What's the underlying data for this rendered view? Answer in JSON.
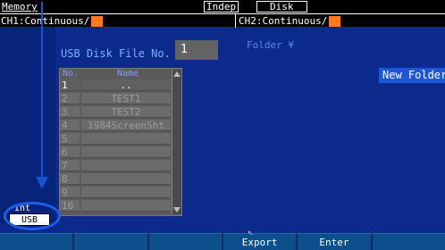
{
  "top_bar": {
    "menu": "Memory",
    "mode_badge": "Indep",
    "storage_badge": "Disk"
  },
  "channels": {
    "ch1": "CH1:Continuous/",
    "ch2": "CH2:Continuous/"
  },
  "panel": {
    "title": "USB Disk File No.",
    "file_no": "1",
    "folder_path": "Folder ¥",
    "new_folder_label": "New Folder"
  },
  "file_list": {
    "headers": {
      "no": "No.",
      "name": "Name"
    },
    "rows": [
      {
        "no": "1",
        "name": ".."
      },
      {
        "no": "2",
        "name": "TEST1"
      },
      {
        "no": "3",
        "name": "TEST2"
      },
      {
        "no": "4",
        "name": "1984ScreenSht"
      },
      {
        "no": "5",
        "name": ""
      },
      {
        "no": "6",
        "name": ""
      },
      {
        "no": "7",
        "name": ""
      },
      {
        "no": "8",
        "name": ""
      },
      {
        "no": "9",
        "name": ""
      },
      {
        "no": "10",
        "name": ""
      }
    ],
    "selected_index": 0
  },
  "media": {
    "int_label": "Int",
    "usb_label": "USB"
  },
  "softkeys": [
    "",
    "",
    "",
    "Export",
    "Enter",
    ""
  ],
  "colors": {
    "background": "#0b2a8c",
    "accent_orange": "#ff7a1a",
    "annotation_blue": "#1452d6",
    "new_folder_bg": "#1e56d8"
  }
}
